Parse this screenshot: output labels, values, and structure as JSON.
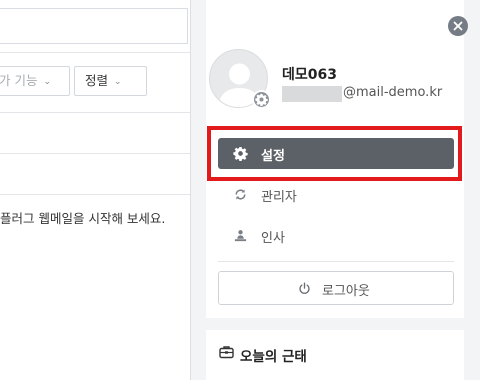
{
  "background": {
    "filter_add_label": "가 기능",
    "sort_label": "정렬",
    "message": "플러그 웹메일을 시작해 보세요."
  },
  "profile": {
    "name": "데모063",
    "email_suffix": "@mail-demo.kr"
  },
  "menu": {
    "items": [
      {
        "label": "설정",
        "icon": "gear-icon",
        "active": true
      },
      {
        "label": "관리자",
        "icon": "sync-icon",
        "active": false
      },
      {
        "label": "인사",
        "icon": "people-icon",
        "active": false
      }
    ],
    "logout_label": "로그아웃"
  },
  "attendance": {
    "title": "오늘의 근태"
  },
  "colors": {
    "active_menu": "#5c6167",
    "highlight": "#e31a1c",
    "panel_bg": "#f3f4f6"
  }
}
